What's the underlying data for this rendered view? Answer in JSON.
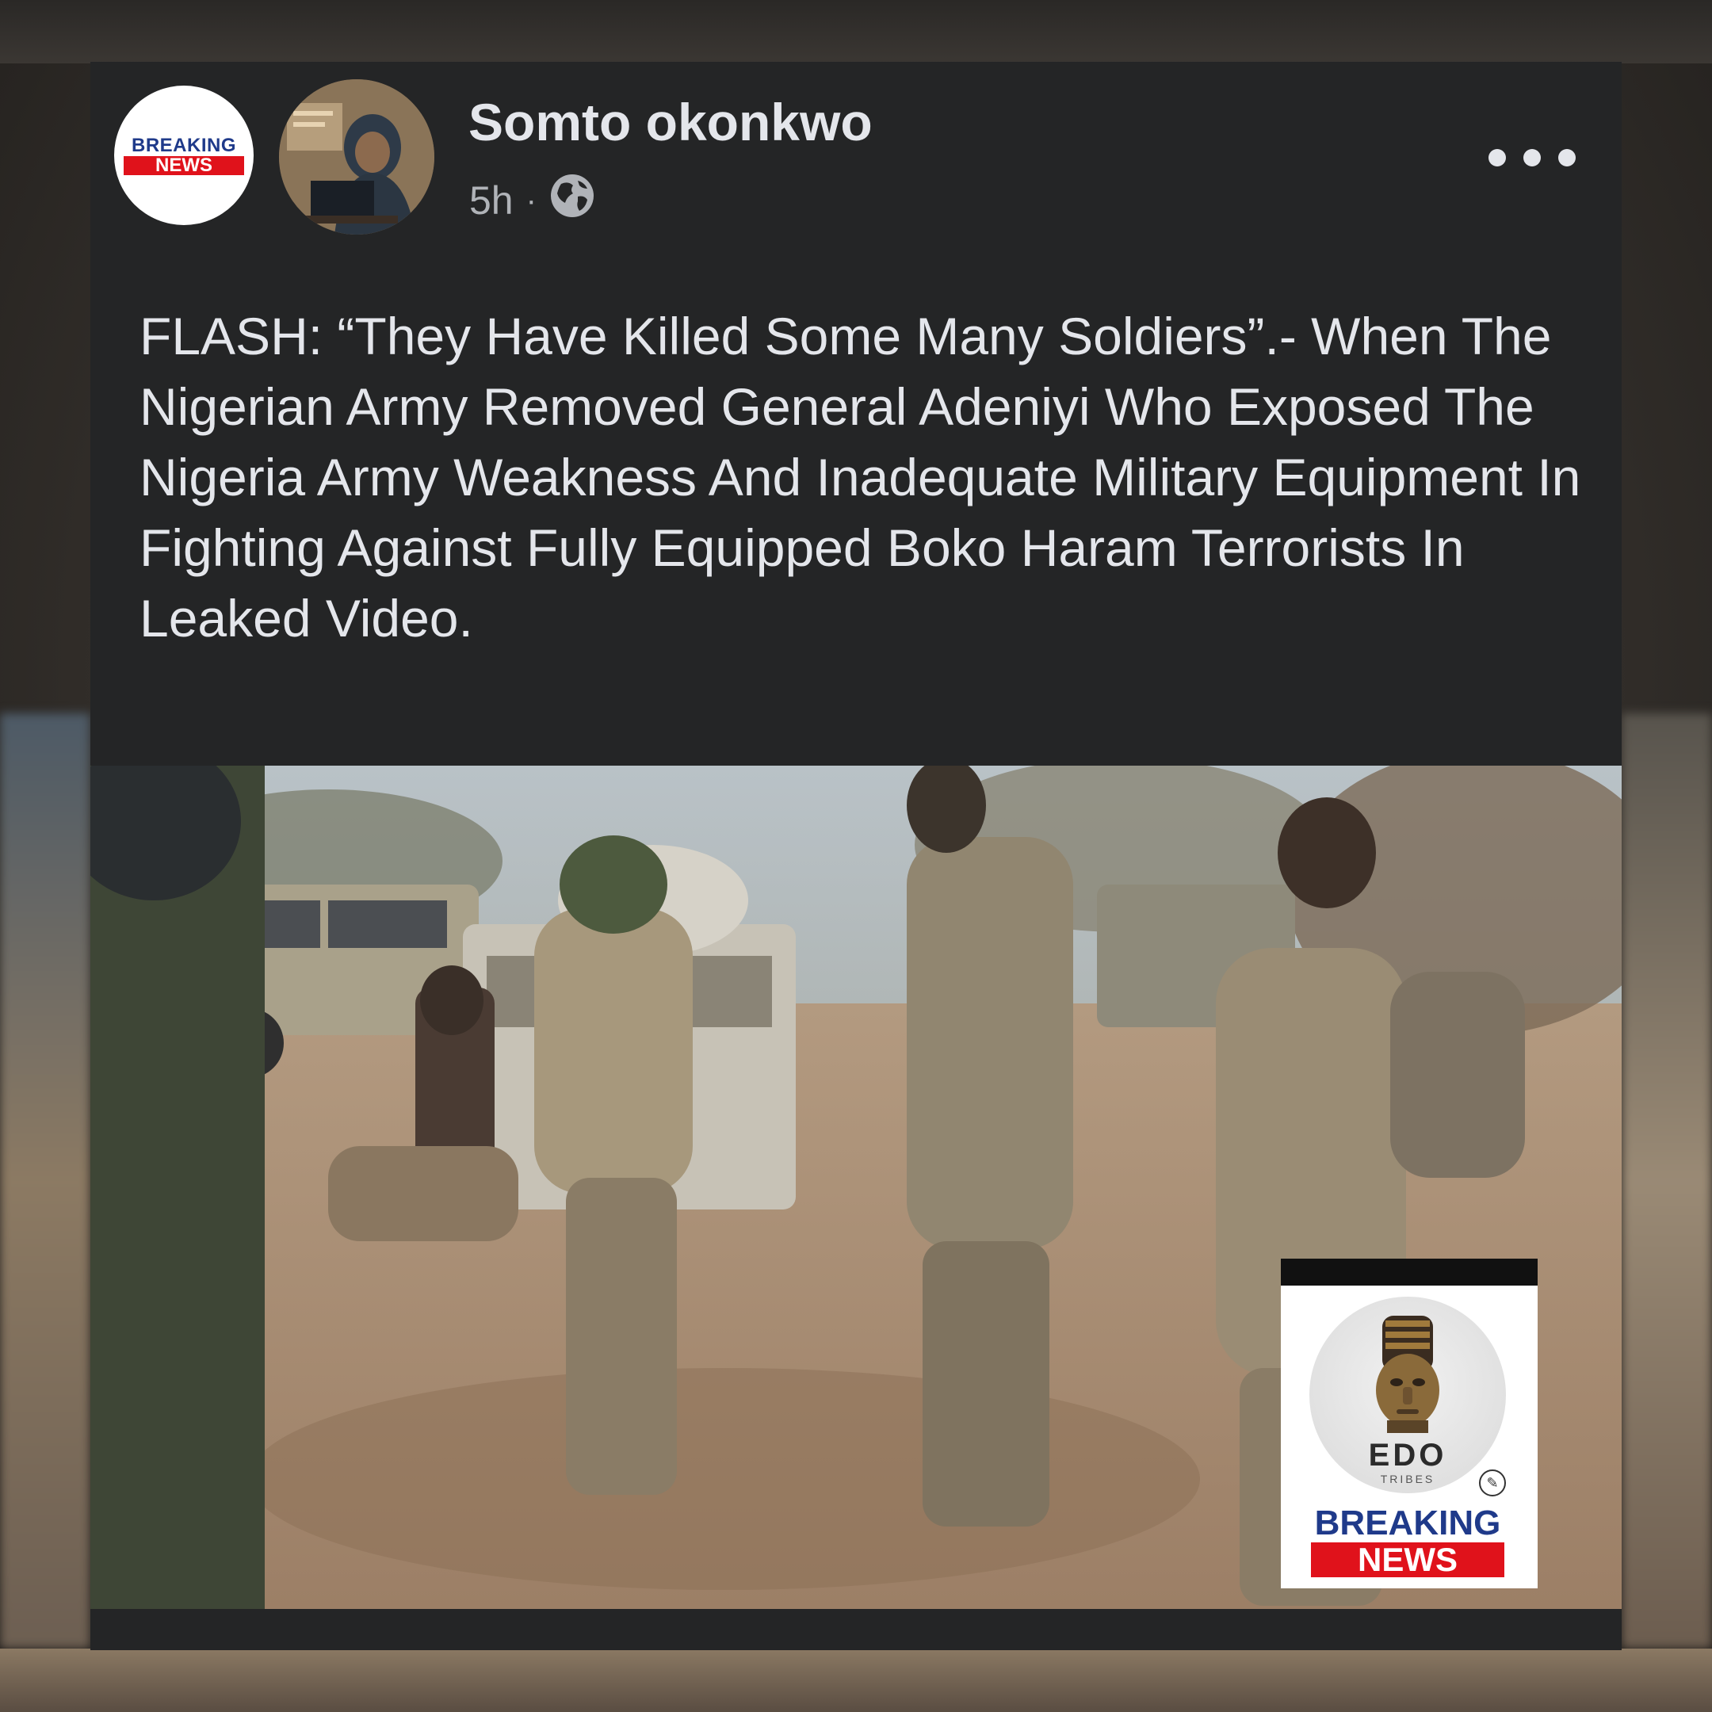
{
  "post": {
    "logo_line1": "BREAKING",
    "logo_line2": "NEWS",
    "author_name": "Somto okonkwo",
    "timestamp": "5h",
    "separator": "·",
    "privacy_icon": "globe-icon",
    "more_icon": "more-options-icon",
    "text": "FLASH: “They Have Killed Some Many Soldiers”.- When The Nigerian Army Removed General Adeniyi Who Exposed The Nigeria Army Weakness And Inadequate Military Equipment In Fighting Against Fully Equipped Boko Haram Terrorists In Leaked Video."
  },
  "brand": {
    "edo": "EDO",
    "tribes": "TRIBES",
    "breaking": "BREAKING",
    "news": "NEWS"
  },
  "colors": {
    "card_bg": "#242526",
    "text_primary": "#e4e6eb",
    "text_secondary": "#b0b3b8",
    "breaking_blue": "#1f3a8a",
    "breaking_red": "#e0121b"
  }
}
